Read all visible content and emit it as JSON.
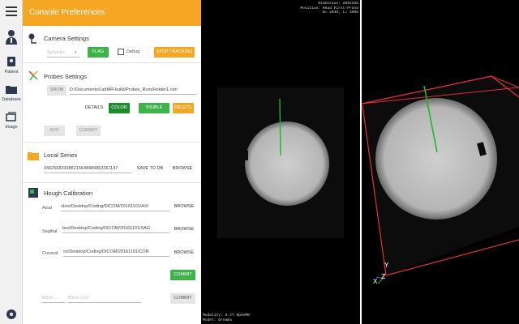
{
  "nav": {
    "items": [
      {
        "label": "Patient"
      },
      {
        "label": "Database"
      },
      {
        "label": "Image"
      }
    ]
  },
  "header": {
    "title": "Console Preferences"
  },
  "camera": {
    "title": "Camera Settings",
    "port_placeholder": "Serial po",
    "flag": "FLAG",
    "debug": "Debug",
    "stop": "STOP TRACKING"
  },
  "probes": {
    "title": "Probes Settings",
    "srom": "SROM",
    "path": "D:/Documents/LabMR-build/Probes_Rom/Holder1.rom",
    "details": "DETAILS",
    "color": "COLOR",
    "visible": "VISIBLE",
    "delete": "DELETE",
    "add": "ADD",
    "commit": "COMMIT"
  },
  "local": {
    "title": "Local Series",
    "uid": "340256833988215648489863361147",
    "save": "SAVE TO DB",
    "browse": "BROWSE"
  },
  "hough": {
    "title": "Hough Calibration",
    "rows": [
      {
        "label": "Axial",
        "path": "sbox/Desktop/Coding/DICOM/20161101/AXI",
        "browse": "BROWSE"
      },
      {
        "label": "Sagittal",
        "path": "box/Desktop/Coding/DICOM/20161101/SAG",
        "browse": "BROWSE"
      },
      {
        "label": "Coronal",
        "path": "ox/Desktop/Coding/DICOM/20161101/COR",
        "browse": "BROWSE"
      }
    ],
    "commit": "COMMIT",
    "minor_placeholder": "Minor ...",
    "minor_crcl_placeholder": "Minor Crcl",
    "commit2": "COMMIT"
  },
  "viewer1": {
    "top_lines": [
      "Dimension: 256x256",
      "Position: Head First-Prone",
      "W= 2048, L= 4096"
    ],
    "bottom_lines": [
      "Modality: 0.7T OpenMR",
      "Model: Dreama"
    ]
  },
  "axes": {
    "y": "Y",
    "x": "X",
    "z": "Z"
  },
  "colors": {
    "header": "#f5a623",
    "green": "#3fb24a",
    "dark_green": "#1e8b2c",
    "orange": "#f5a623",
    "needle": "#1fb81f",
    "box": "#e0303a"
  }
}
